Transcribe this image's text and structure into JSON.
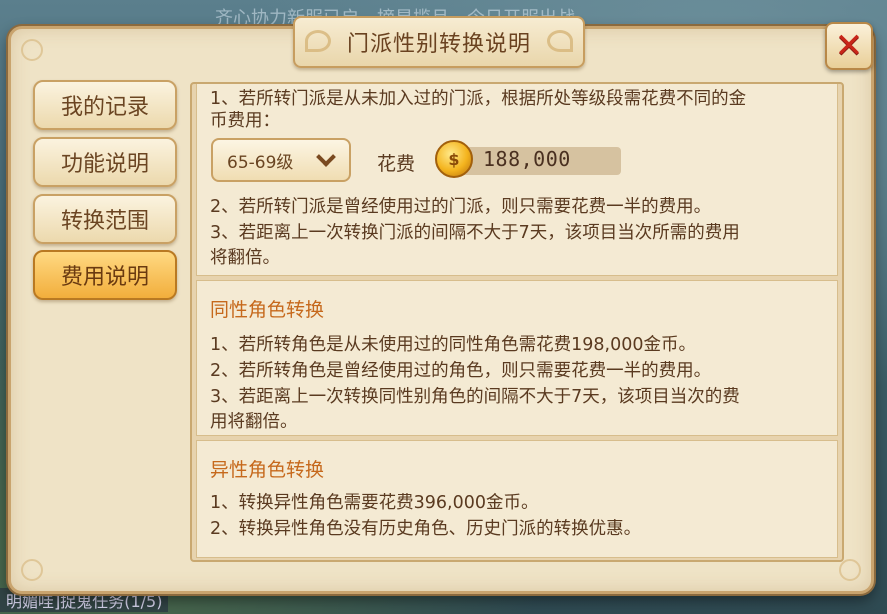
{
  "background": {
    "top_text": "齐心协力新服已启，摘星揽月…今日开服出战",
    "bottom_text": "明媚哇]捉鬼任务(1/5)"
  },
  "dialog": {
    "title": "门派性别转换说明",
    "close_label": "✕"
  },
  "tabs": [
    {
      "label": "我的记录",
      "active": false
    },
    {
      "label": "功能说明",
      "active": false
    },
    {
      "label": "转换范围",
      "active": false
    },
    {
      "label": "费用说明",
      "active": true
    }
  ],
  "sect_change": {
    "line1a": "1、若所转门派是从未加入过的门派，根据所处等级段需花费不同的金",
    "line1b": "币费用：",
    "level_select": "65-69级",
    "fee_label": "花费",
    "fee_value": "188,000",
    "line2": "2、若所转门派是曾经使用过的门派，则只需要花费一半的费用。",
    "line3a": "3、若距离上一次转换门派的间隔不大于7天，该项目当次所需的费用",
    "line3b": "将翻倍。"
  },
  "same_gender": {
    "heading": "同性角色转换",
    "line1": "1、若所转角色是从未使用过的同性角色需花费198,000金币。",
    "line2": "2、若所转角色是曾经使用过的角色，则只需要花费一半的费用。",
    "line3a": "3、若距离上一次转换同性别角色的间隔不大于7天，该项目当次的费",
    "line3b": "用将翻倍。"
  },
  "diff_gender": {
    "heading": "异性角色转换",
    "line1": "1、转换异性角色需要花费396,000金币。",
    "line2": "2、转换异性角色没有历史角色、历史门派的转换优惠。"
  },
  "colors": {
    "panel_bg": "#efe3c6",
    "heading": "#c6691c",
    "text": "#5a3a20",
    "active_tab": "#f2ae3c",
    "close_x": "#c8261a"
  },
  "icons": {
    "close": "close-icon",
    "coin": "gold-coin-icon",
    "dropdown": "chevron-down-icon"
  }
}
